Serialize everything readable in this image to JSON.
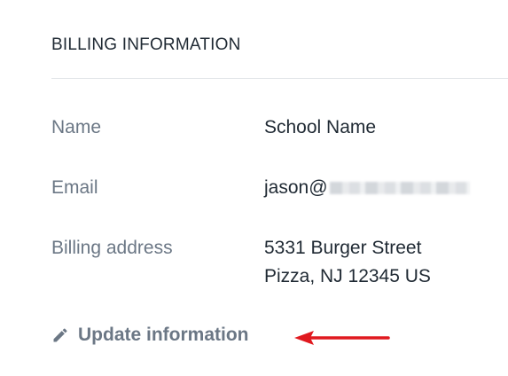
{
  "section": {
    "title": "BILLING INFORMATION"
  },
  "rows": [
    {
      "label": "Name",
      "value": "School Name"
    },
    {
      "label": "Email",
      "value": "jason@"
    },
    {
      "label": "Billing address",
      "value_line1": "5331 Burger Street",
      "value_line2": "Pizza, NJ 12345 US"
    }
  ],
  "actions": {
    "update_label": "Update information",
    "update_icon": "pencil-icon"
  },
  "annotation": {
    "arrow_color": "#e0191f"
  },
  "colors": {
    "label": "#6b7785",
    "value": "#1f2933",
    "divider": "#e3e6ea"
  }
}
